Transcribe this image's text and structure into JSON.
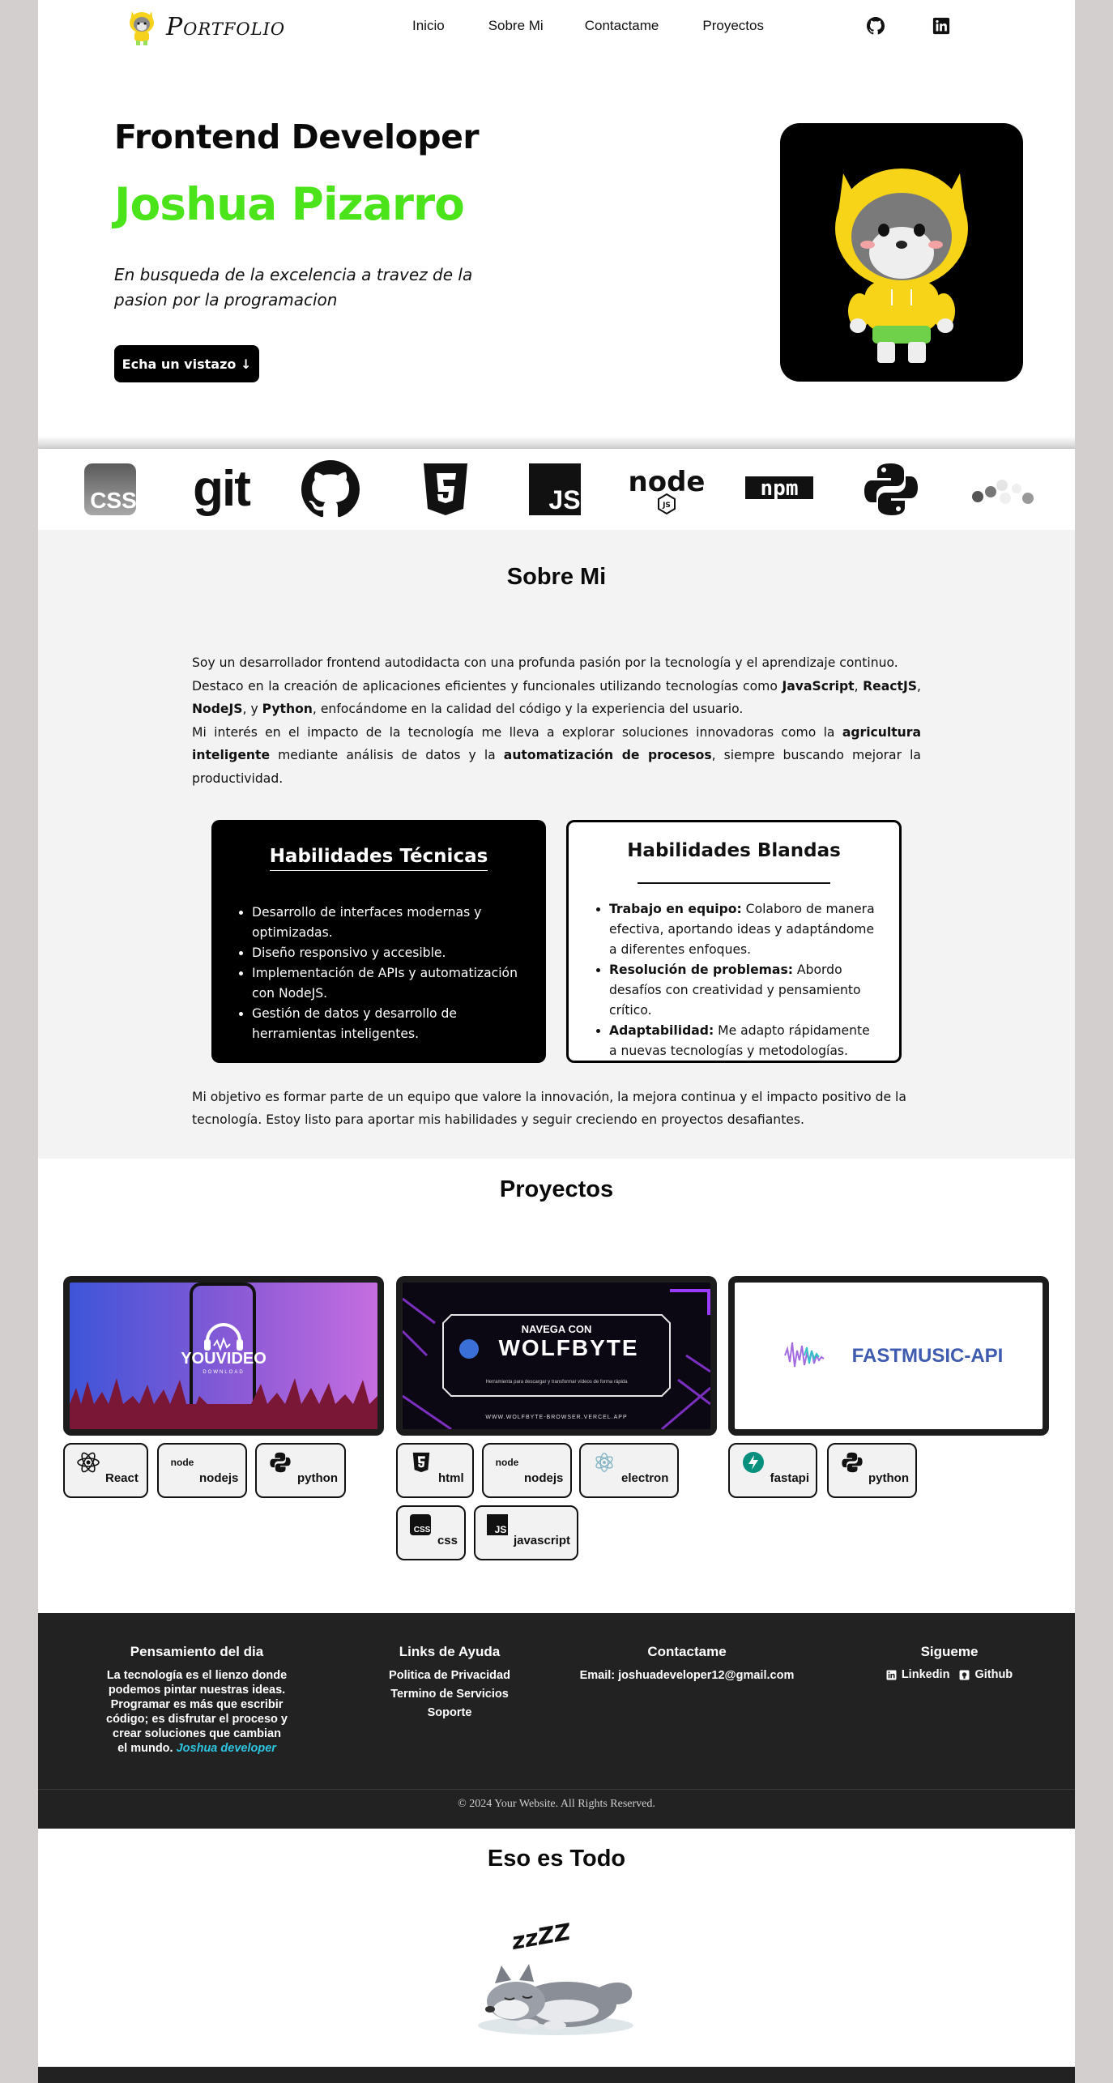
{
  "header": {
    "logo_text": "Portfolio",
    "nav": [
      "Inicio",
      "Sobre Mi",
      "Contactame",
      "Proyectos"
    ],
    "social_icons": [
      "github-icon",
      "linkedin-icon"
    ]
  },
  "hero": {
    "role": "Frontend Developer",
    "name": "Joshua Pizarro",
    "tagline": "En busqueda de la excelencia a travez de la pasion por la programacion",
    "cta": "Echa un vistazo ↓",
    "name_color": "#4be41b"
  },
  "tech_strip": {
    "css_label": "CSS",
    "git_label": "git",
    "js_label": "JS",
    "npm_label": "npm",
    "node_label": "node",
    "node_badge": "JS",
    "icons": [
      "css-icon",
      "git-icon",
      "github-icon",
      "html5-icon",
      "javascript-icon",
      "nodejs-icon",
      "npm-icon",
      "python-icon",
      "dots-icon"
    ]
  },
  "about": {
    "title": "Sobre Mi",
    "p1": "Soy un desarrollador frontend autodidacta con una profunda pasión por la tecnología y el aprendizaje continuo.",
    "p2_a": "Destaco en la creación de aplicaciones eficientes y funcionales utilizando tecnologías como ",
    "p2_b1": "JavaScript",
    "p2_c": ", ",
    "p2_b2": "ReactJS",
    "p2_d": ", ",
    "p2_b3": "NodeJS",
    "p2_e": ", y ",
    "p2_b4": "Python",
    "p2_f": ", enfocándome en la calidad del código y la experiencia del usuario.",
    "p3_a": "Mi interés en el impacto de la tecnología me lleva a explorar soluciones innovadoras como la ",
    "p3_b1": "agricultura inteligente",
    "p3_c": " mediante análisis de datos y la ",
    "p3_b2": "automatización de procesos",
    "p3_d": ", siempre buscando mejorar la productividad.",
    "tech_card": {
      "title": "Habilidades Técnicas",
      "items": [
        "Desarrollo de interfaces modernas y optimizadas.",
        "Diseño responsivo y accesible.",
        "Implementación de APIs y automatización con NodeJS.",
        "Gestión de datos y desarrollo de herramientas inteligentes."
      ]
    },
    "soft_card": {
      "title": "Habilidades Blandas",
      "items": [
        {
          "label": "Trabajo en equipo:",
          "text": " Colaboro de manera efectiva, aportando ideas y adaptándome a diferentes enfoques."
        },
        {
          "label": "Resolución de problemas:",
          "text": " Abordo desafíos con creatividad y pensamiento crítico."
        },
        {
          "label": "Adaptabilidad:",
          "text": " Me adapto rápidamente a nuevas tecnologías y metodologías."
        }
      ]
    },
    "goal": "Mi objetivo es formar parte de un equipo que valore la innovación, la mejora continua y el impacto positivo de la tecnología. Estoy listo para aportar mis habilidades y seguir creciendo en proyectos desafiantes."
  },
  "projects": {
    "title": "Proyectos",
    "items": [
      {
        "image_text": "YOUVIDEO",
        "image_sub": "DOWNLOAD",
        "chips": [
          "React",
          "nodejs",
          "python"
        ]
      },
      {
        "image_top": "NAVEGA CON",
        "image_text": "WOLFBYTE",
        "image_small": "Herramienta para descargar y transformar vídeos de forma rápida",
        "image_url": "WWW.WOLFBYTE-BROWSER.VERCEL.APP",
        "chips": [
          "html",
          "nodejs",
          "electron",
          "css",
          "javascript"
        ]
      },
      {
        "image_text": "FASTMUSIC-API",
        "chips": [
          "fastapi",
          "python"
        ]
      }
    ],
    "node_small": "node"
  },
  "footer": {
    "thought_title": "Pensamiento del dia",
    "thought_text": "La tecnología es el lienzo donde podemos pintar nuestras ideas. Programar es más que escribir código; es disfrutar el proceso y crear soluciones que cambian el mundo.",
    "thought_author": "Joshua developer",
    "links_title": "Links de Ayuda",
    "links": [
      "Politica de Privacidad",
      "Termino de Servicios",
      "Soporte"
    ],
    "contact_title": "Contactame",
    "contact_email": "Email: joshuadeveloper12@gmail.com",
    "follow_title": "Sigueme",
    "follow_links": [
      "Linkedin",
      "Github"
    ],
    "copyright": "© 2024 Your Website. All Rights Reserved.",
    "accent": "#2ec4e0"
  },
  "end": {
    "title": "Eso es Todo",
    "zzz": "zzZZ"
  }
}
